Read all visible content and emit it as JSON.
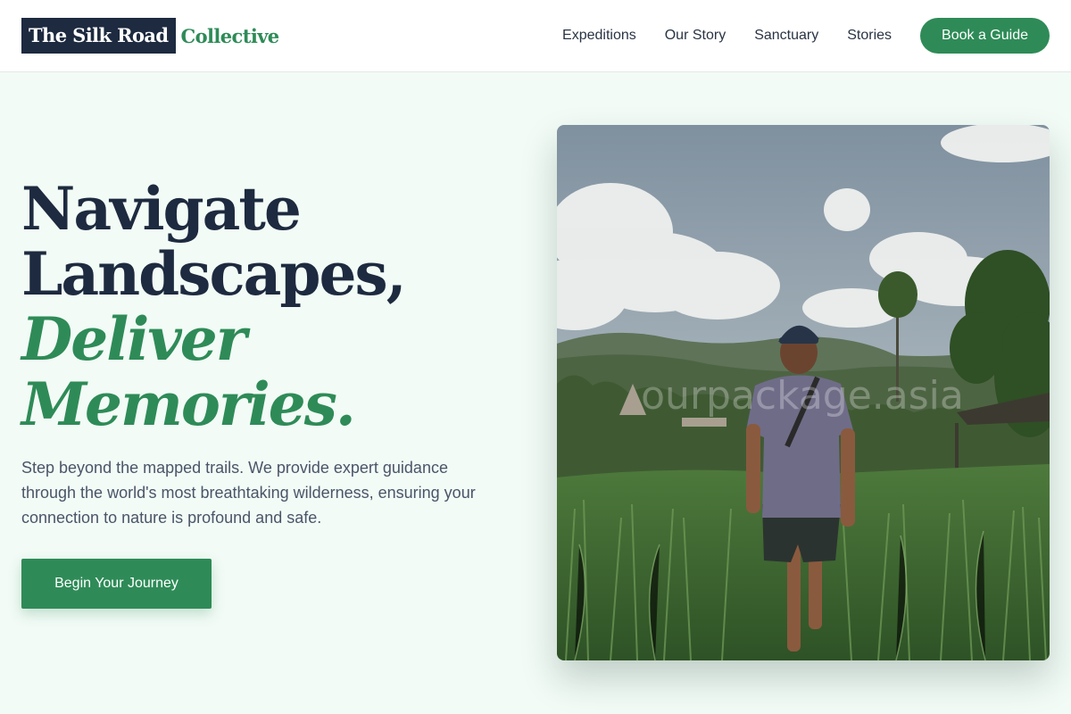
{
  "header": {
    "logo_dark": "The Silk Road",
    "logo_green": "Collective",
    "nav": [
      "Expeditions",
      "Our Story",
      "Sanctuary",
      "Stories"
    ],
    "cta_label": "Book a Guide"
  },
  "hero": {
    "title_line1": "Navigate",
    "title_line2": "Landscapes,",
    "title_line3": "Deliver",
    "title_line4": "Memories.",
    "description": "Step beyond the mapped trails. We provide expert guidance through the world's most breathtaking wilderness, ensuring your connection to nature is profound and safe.",
    "button_label": "Begin Your Journey",
    "image_watermark": "ourpackage.asia"
  },
  "colors": {
    "accent": "#2e8b57",
    "navy": "#1d2a3f",
    "background": "#f2fbf6"
  }
}
